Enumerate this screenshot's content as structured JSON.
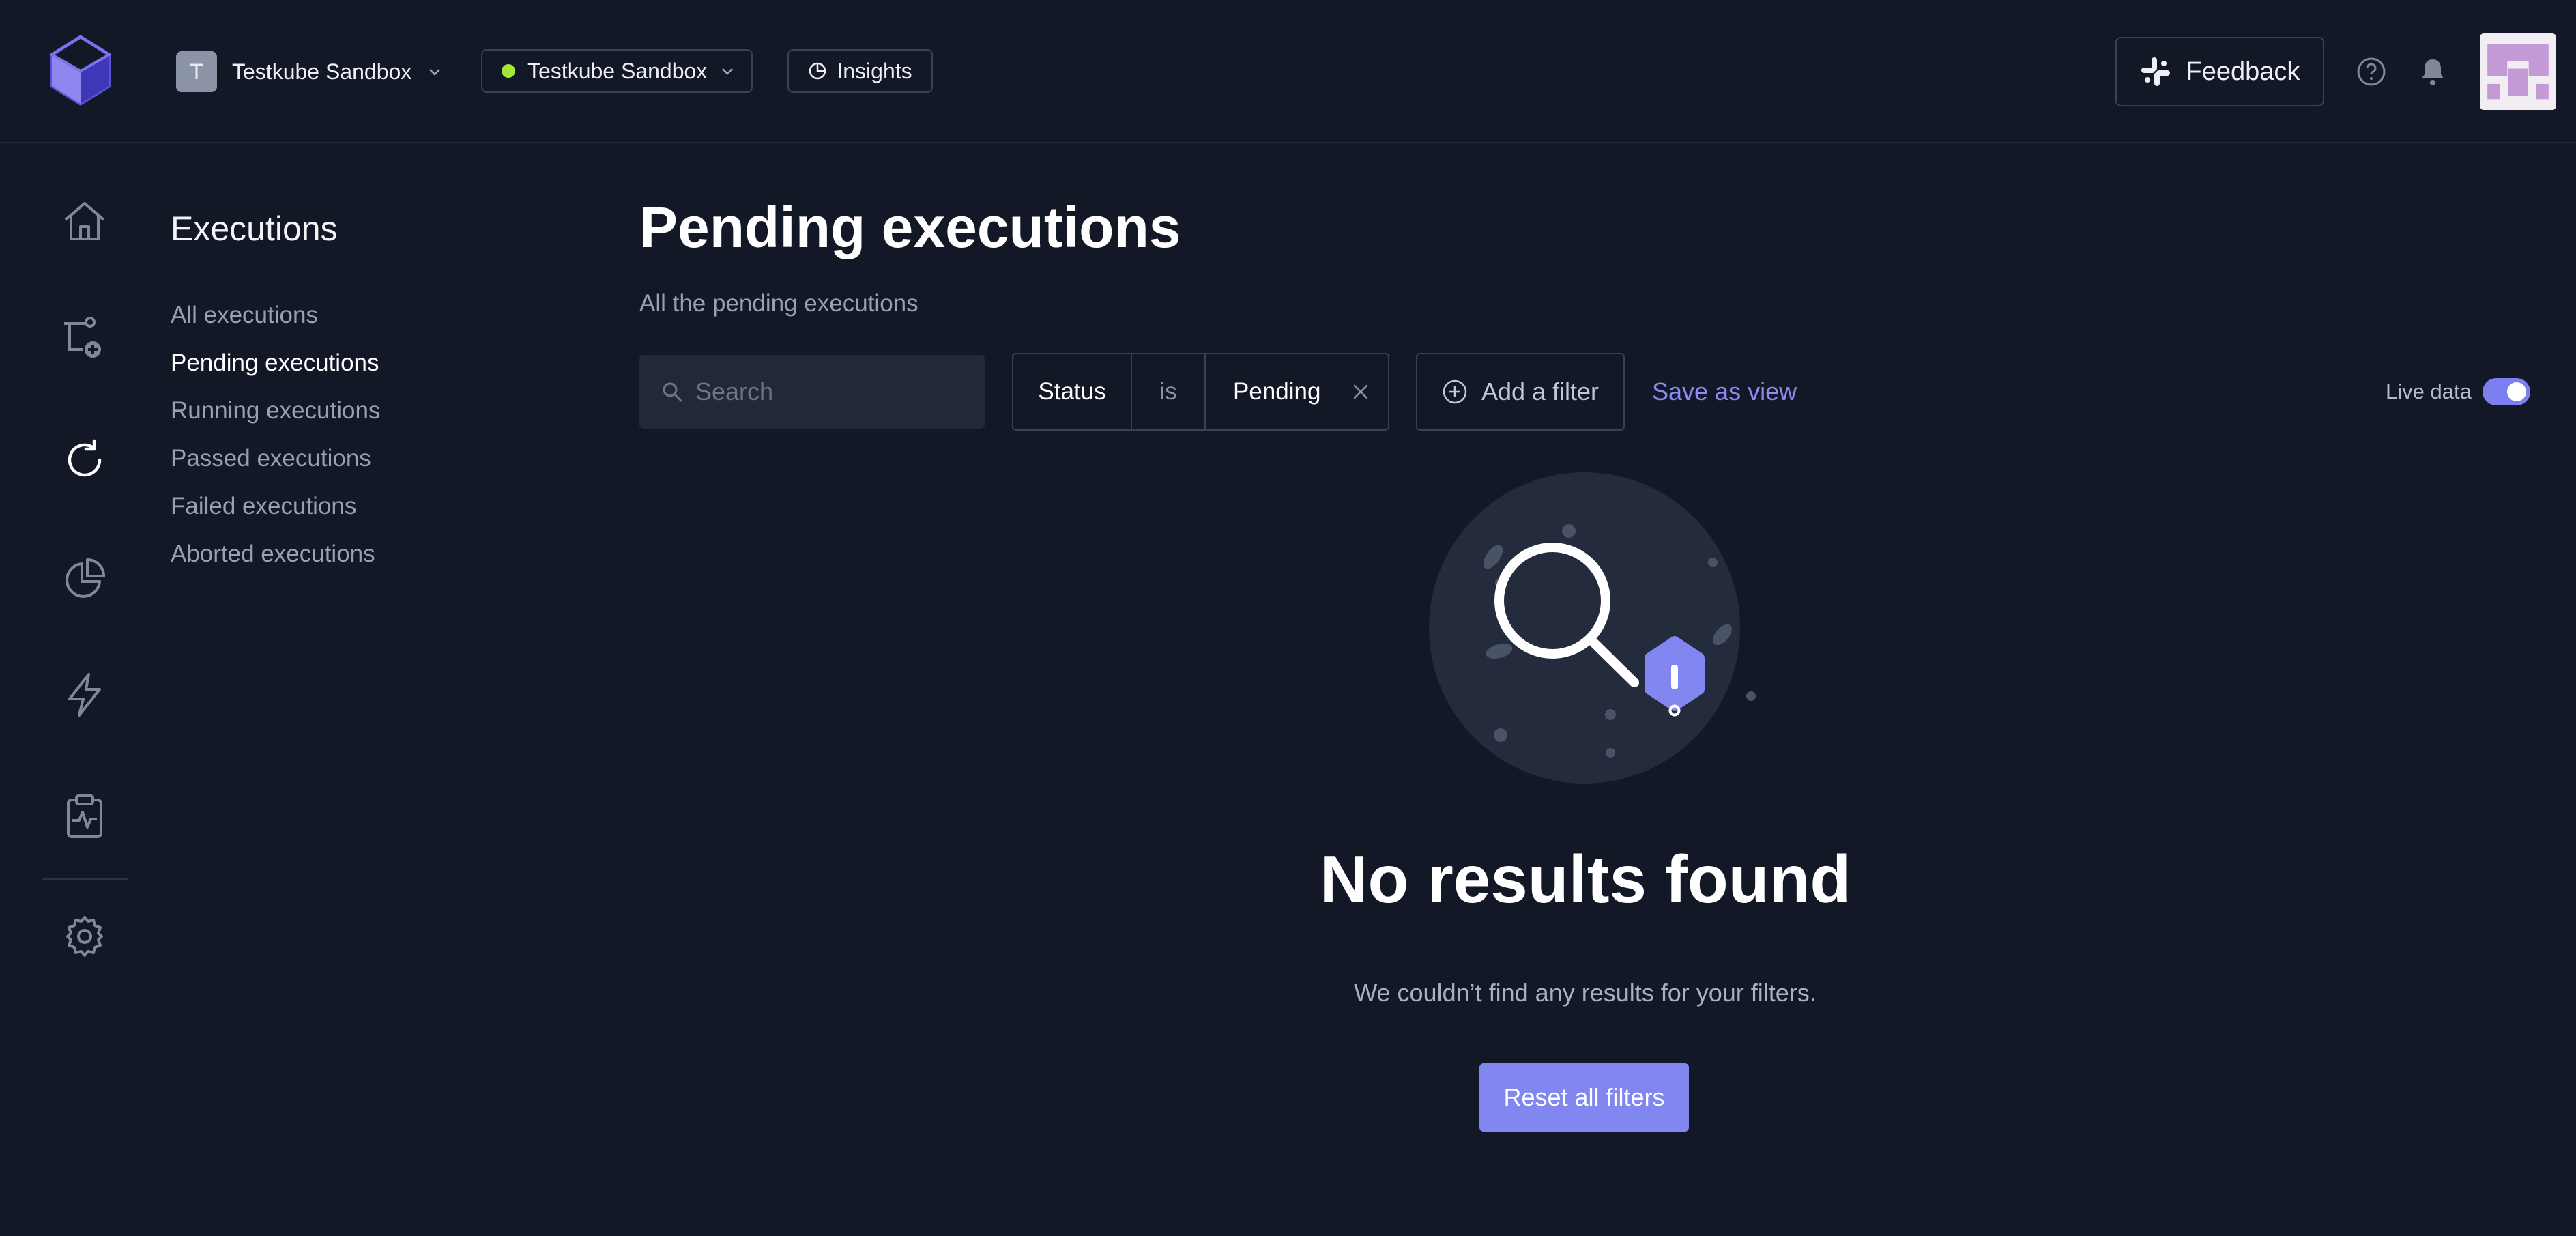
{
  "header": {
    "org": {
      "initial": "T",
      "name": "Testkube Sandbox"
    },
    "environment": {
      "name": "Testkube Sandbox",
      "status_color": "#a3e635"
    },
    "insights_label": "Insights",
    "feedback_label": "Feedback"
  },
  "rail": {
    "icons": [
      "home-icon",
      "test-workflows-icon",
      "executions-icon",
      "analytics-icon",
      "triggers-icon",
      "reports-icon",
      "settings-icon"
    ]
  },
  "sidebar": {
    "title": "Executions",
    "items": [
      {
        "label": "All executions",
        "active": false
      },
      {
        "label": "Pending executions",
        "active": true
      },
      {
        "label": "Running executions",
        "active": false
      },
      {
        "label": "Passed executions",
        "active": false
      },
      {
        "label": "Failed executions",
        "active": false
      },
      {
        "label": "Aborted executions",
        "active": false
      }
    ]
  },
  "main": {
    "title": "Pending executions",
    "subtitle": "All the pending executions",
    "search": {
      "placeholder": "Search",
      "value": ""
    },
    "filter": {
      "field": "Status",
      "operator": "is",
      "value": "Pending"
    },
    "add_filter_label": "Add a filter",
    "save_view_label": "Save as view",
    "live_data": {
      "label": "Live data",
      "enabled": true
    },
    "empty_state": {
      "title": "No results found",
      "message": "We couldn’t find any results for your filters.",
      "reset_label": "Reset all filters"
    }
  },
  "colors": {
    "background": "#121826",
    "accent": "#8286f0",
    "link": "#8b8cf2",
    "env_online": "#a3e635"
  }
}
